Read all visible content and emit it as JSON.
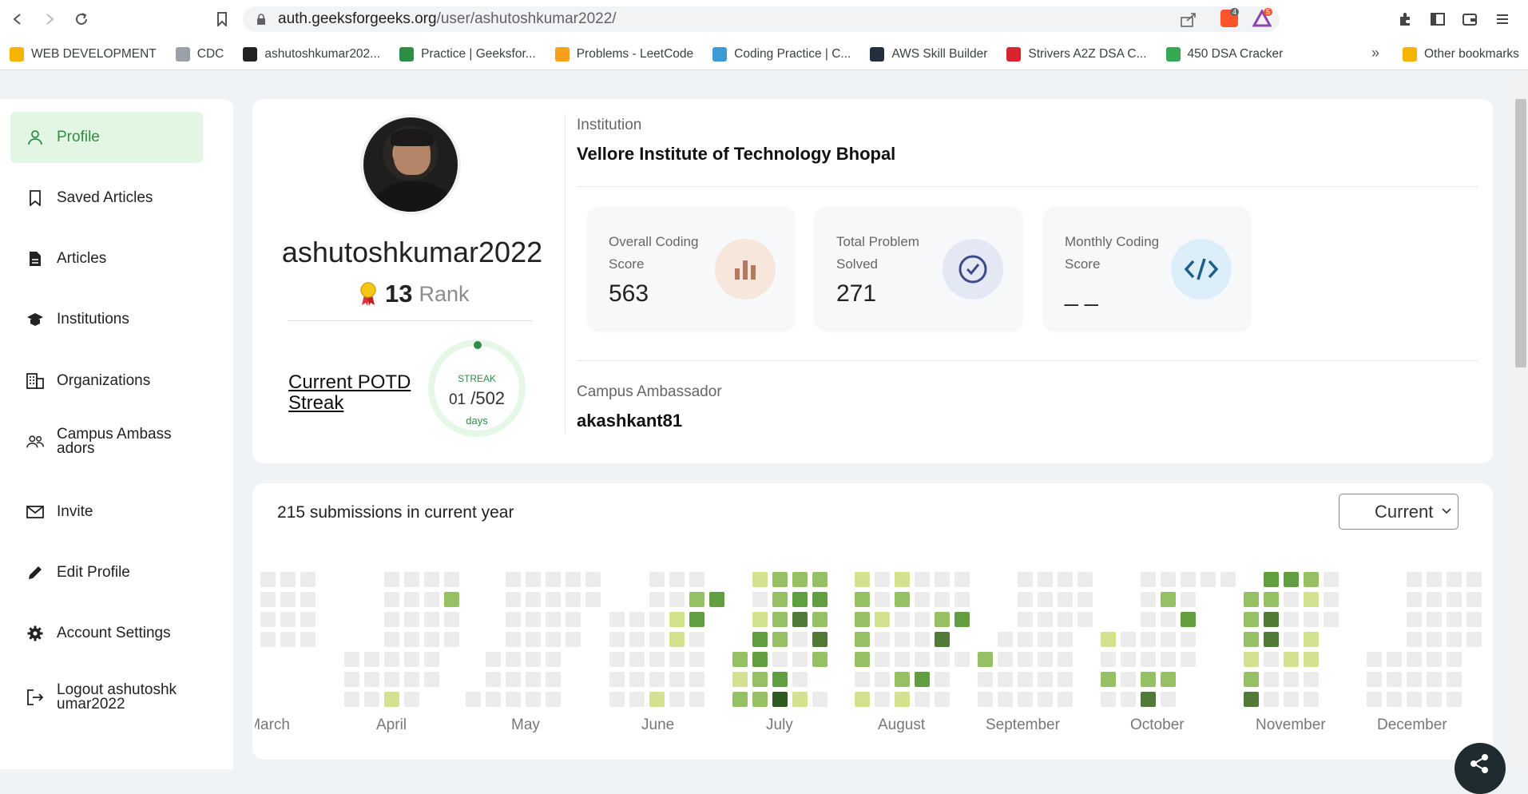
{
  "browser": {
    "url_host": "auth.geeksforgeeks.org",
    "url_path": "/user/ashutoshkumar2022/",
    "ext_badge_1": "4",
    "ext_badge_2": "5"
  },
  "bookmarks": [
    {
      "label": "WEB DEVELOPMENT",
      "icon": "folder-icon",
      "color": "#f5b400"
    },
    {
      "label": "CDC",
      "icon": "cdc-icon",
      "color": "#9aa0a6"
    },
    {
      "label": "ashutoshkumar202...",
      "icon": "github-icon",
      "color": "#222222"
    },
    {
      "label": "Practice | Geeksfor...",
      "icon": "gfg-icon",
      "color": "#2f8d46"
    },
    {
      "label": "Problems - LeetCode",
      "icon": "leetcode-icon",
      "color": "#f89f1b"
    },
    {
      "label": "Coding Practice | C...",
      "icon": "coding-practice-icon",
      "color": "#3c9bd6"
    },
    {
      "label": "AWS Skill Builder",
      "icon": "aws-icon",
      "color": "#232f3e"
    },
    {
      "label": "Strivers A2Z DSA C...",
      "icon": "tuf-icon",
      "color": "#d9232d"
    },
    {
      "label": "450 DSA Cracker",
      "icon": "450-icon",
      "color": "#34a853"
    }
  ],
  "bookmarks_other": "Other bookmarks",
  "sidebar": {
    "items": [
      {
        "label": "Profile",
        "icon": "person-icon",
        "active": true
      },
      {
        "label": "Saved Articles",
        "icon": "bookmark-icon"
      },
      {
        "label": "Articles",
        "icon": "document-icon"
      },
      {
        "label": "Institutions",
        "icon": "graduation-cap-icon"
      },
      {
        "label": "Organizations",
        "icon": "building-icon"
      },
      {
        "label": "Campus Ambassadors",
        "icon": "people-icon"
      },
      {
        "label": "Invite",
        "icon": "mail-icon"
      },
      {
        "label": "Edit Profile",
        "icon": "pencil-icon"
      },
      {
        "label": "Account Settings",
        "icon": "gear-icon"
      },
      {
        "label": "Logout ashutoshkumar2022",
        "icon": "logout-icon"
      }
    ]
  },
  "profile": {
    "username": "ashutoshkumar2022",
    "rank_number": "13",
    "rank_label": "Rank",
    "potd_label": "Current POTD Streak",
    "streak_title": "STREAK",
    "streak_current": "01",
    "streak_total": "/502",
    "streak_unit": "days"
  },
  "institution": {
    "label": "Institution",
    "name": "Vellore Institute of Technology Bhopal"
  },
  "stats": [
    {
      "label": "Overall Coding Score",
      "value": "563",
      "icon": "bar-chart-icon",
      "bg": "#f7e6dc",
      "fg": "#b47a5f"
    },
    {
      "label": "Total Problem Solved",
      "value": "271",
      "icon": "check-badge-icon",
      "bg": "#e4e8f5",
      "fg": "#3e4a85"
    },
    {
      "label": "Monthly Coding Score",
      "value": "_ _",
      "icon": "code-icon",
      "bg": "#dceef9",
      "fg": "#1d5f88"
    }
  ],
  "ambassador": {
    "label": "Campus Ambassador",
    "name": "akashkant81"
  },
  "heatmap": {
    "title": "215 submissions in current year",
    "select_value": "Current",
    "months": [
      "March",
      "April",
      "May",
      "June",
      "July",
      "August",
      "September",
      "October",
      "November",
      "December"
    ],
    "colors": {
      "empty": "#ececec",
      "l1": "#d3e28e",
      "l2": "#95c064",
      "l3": "#609e3f",
      "l4": "#507a35",
      "l5": "#2f5a20"
    }
  }
}
